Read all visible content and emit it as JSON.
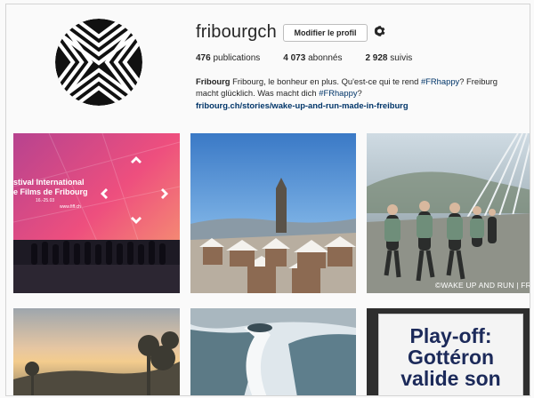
{
  "profile": {
    "username": "fribourgch",
    "edit_button": "Modifier le profil",
    "settings_icon": "gear-icon",
    "avatar_icon": "chevron-pattern-logo"
  },
  "stats": {
    "posts_count": "476",
    "posts_label": "publications",
    "followers_count": "4 073",
    "followers_label": "abonnés",
    "following_count": "2 928",
    "following_label": "suivis"
  },
  "bio": {
    "name": "Fribourg",
    "text_1": "Fribourg, le bonheur en plus. Qu'est-ce qui te rend",
    "hashtag_1": "#FRhappy",
    "text_2": "? Freiburg macht glücklich. Was macht dich",
    "hashtag_2": "#FRhappy",
    "text_3": "?",
    "link": "fribourg.ch/stories/wake-up-and-run-made-in-freiburg"
  },
  "posts": [
    {
      "title_1": "stival International",
      "title_2": "e Films de Fribourg",
      "date_1": "16.-25.03",
      "date_2": "www.fiff.ch"
    },
    {},
    {
      "watermark": "©WAKE UP AND RUN | FR"
    },
    {},
    {},
    {
      "poster_line_1": "Play-off:",
      "poster_line_2": "Gottéron",
      "poster_line_3": "valide son"
    }
  ],
  "colors": {
    "link": "#003569",
    "text": "#262626",
    "background": "#fafafa",
    "poster_text": "#1c2a5a"
  }
}
